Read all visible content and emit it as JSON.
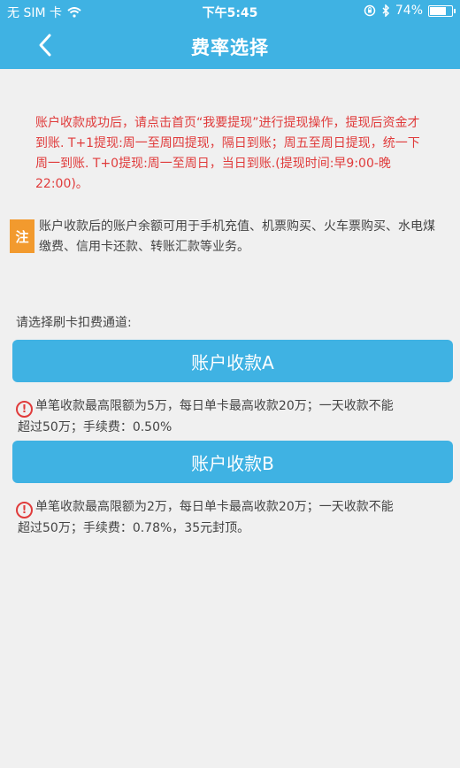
{
  "status_bar": {
    "carrier": "无 SIM 卡",
    "time": "下午5:45",
    "battery": "74%",
    "battery_level": 0.74
  },
  "nav": {
    "title": "费率选择"
  },
  "notice_red": "账户收款成功后，请点击首页“我要提现”进行提现操作，提现后资金才到账. T+1提现:周一至周四提现，隔日到账；周五至周日提现，统一下周一到账. T+0提现:周一至周日，当日到账.(提现时间:早9:00-晚22:00)。",
  "note": {
    "tag": "注",
    "text": "账户收款后的账户余额可用于手机充值、机票购买、火车票购买、水电煤缴费、信用卡还款、转账汇款等业务。"
  },
  "choose_label": "请选择刷卡扣费通道:",
  "channels": [
    {
      "label": "账户收款A",
      "info_line1": "单笔收款最高限额为5万，每日单卡最高收款20万；一天收款不能",
      "info_line2": "超过50万；手续费：0.50%"
    },
    {
      "label": "账户收款B",
      "info_line1": "单笔收款最高限额为2万，每日单卡最高收款20万；一天收款不能",
      "info_line2": "超过50万；手续费：0.78%，35元封顶。"
    }
  ],
  "colors": {
    "primary": "#3fb2e3",
    "warning_text": "#e03b3b",
    "note_tag": "#f29a2e",
    "background": "#f0f0f0"
  },
  "icons": {
    "wifi": "wifi-icon",
    "lock": "orientation-lock-icon",
    "bluetooth": "bluetooth-icon",
    "back": "chevron-left-icon",
    "warning": "warning-icon"
  }
}
